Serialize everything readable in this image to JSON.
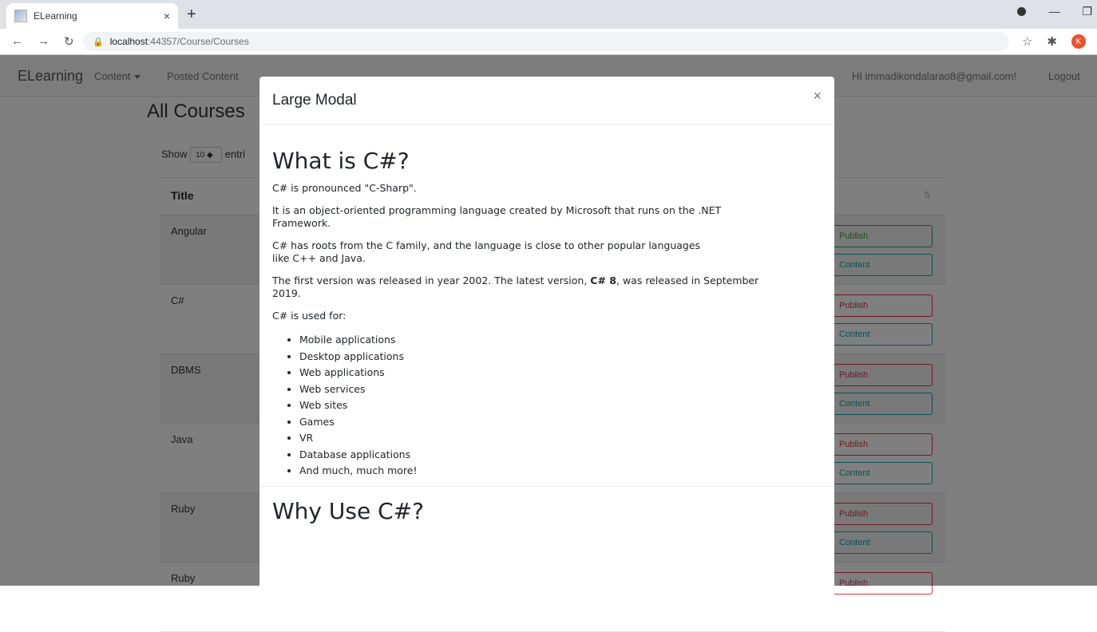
{
  "browser": {
    "tab_title": "ELearning",
    "tab_close": "×",
    "new_tab": "+",
    "url_host": "localhost",
    "url_path": ":44357/Course/Courses",
    "avatar_letter": "K"
  },
  "app": {
    "brand": "ELearning",
    "nav": {
      "content": "Content",
      "posted": "Posted Content"
    },
    "greeting": "HI immadikondalarao8@gmail.com!",
    "logout": "Logout"
  },
  "page": {
    "title": "All Courses",
    "show_label": "Show",
    "page_size": "10 ◆",
    "entries_label": "entri",
    "column_title": "Title",
    "rows": [
      {
        "title": "Angular",
        "publish": "Publish",
        "publish_color": "#28a745",
        "view": "Content"
      },
      {
        "title": "C#",
        "publish": "Publish",
        "publish_color": "#dc3545",
        "view": "Content"
      },
      {
        "title": "DBMS",
        "publish": "Publish",
        "publish_color": "#dc3545",
        "view": "Content"
      },
      {
        "title": "Java",
        "publish": "Publish",
        "publish_color": "#dc3545",
        "view": "Content"
      },
      {
        "title": "Ruby",
        "publish": "Publish",
        "publish_color": "#dc3545",
        "view": "Content"
      },
      {
        "title": "Ruby",
        "publish": "Publish",
        "publish_color": "#dc3545",
        "view": ""
      }
    ]
  },
  "modal": {
    "title": "Large Modal",
    "close": "×",
    "heading": "What is C#?",
    "p1": "C# is pronounced \"C-Sharp\".",
    "p2a": "It is an object-oriented programming language created by Microsoft that runs on the .NET",
    "p2b": "Framework.",
    "p3a": "C# has roots from the C family, and the language is close to other popular languages",
    "p3b": "like C++ and Java.",
    "p4_pre": "The first version was released in year 2002. The latest version, ",
    "p4_bold": "C# 8",
    "p4_post": ", was released in September",
    "p4b": "2019.",
    "p5": "C# is used for:",
    "uses": [
      "Mobile applications",
      "Desktop applications",
      "Web applications",
      "Web services",
      "Web sites",
      "Games",
      "VR",
      "Database applications",
      "And much, much more!"
    ],
    "heading2": "Why Use C#?"
  },
  "colors": {
    "view_button": "#17a2b8",
    "overlay": "rgba(0,0,0,0.5)"
  }
}
